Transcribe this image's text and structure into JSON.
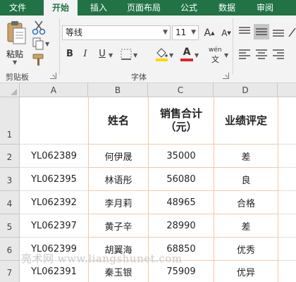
{
  "tabs": [
    "文件",
    "开始",
    "插入",
    "页面布局",
    "公式",
    "数据",
    "审阅"
  ],
  "active_tab": 1,
  "clipboard": {
    "paste_label": "粘贴",
    "group_label": "剪贴板",
    "icons": [
      "paste-icon",
      "cut-icon",
      "copy-icon",
      "format-painter-icon"
    ]
  },
  "font": {
    "font_name": "等线",
    "font_size": "11",
    "grow_label": "A",
    "shrink_label": "A",
    "bold_label": "B",
    "italic_label": "I",
    "underline_label": "U",
    "color_label": "A",
    "phonetic_label": "wén",
    "group_label": "字体",
    "colors": {
      "fill": "#ffd700",
      "font": "#e0242b"
    }
  },
  "columns": [
    "A",
    "B",
    "C",
    "D"
  ],
  "rows": [
    "1",
    "2",
    "3",
    "4",
    "5",
    "6",
    "7"
  ],
  "headers": {
    "name": "姓名",
    "sales_line1": "销售合计",
    "sales_line2": "（元）",
    "rating": "业绩评定"
  },
  "records": [
    {
      "id": "YL062389",
      "name": "何伊晟",
      "sales": "35000",
      "rating": "差"
    },
    {
      "id": "YL062395",
      "name": "林语彤",
      "sales": "56080",
      "rating": "良"
    },
    {
      "id": "YL062392",
      "name": "李月莉",
      "sales": "48965",
      "rating": "合格"
    },
    {
      "id": "YL062397",
      "name": "黄子辛",
      "sales": "28990",
      "rating": "差"
    },
    {
      "id": "YL062399",
      "name": "胡翼海",
      "sales": "68850",
      "rating": "优秀"
    },
    {
      "id": "YL062391",
      "name": "秦玉银",
      "sales": "75909",
      "rating": "优异"
    }
  ],
  "watermark": "亮术网 www.liangshunet.com",
  "theme": {
    "excel_green": "#217346",
    "border_orange": "#f2c9a8"
  }
}
